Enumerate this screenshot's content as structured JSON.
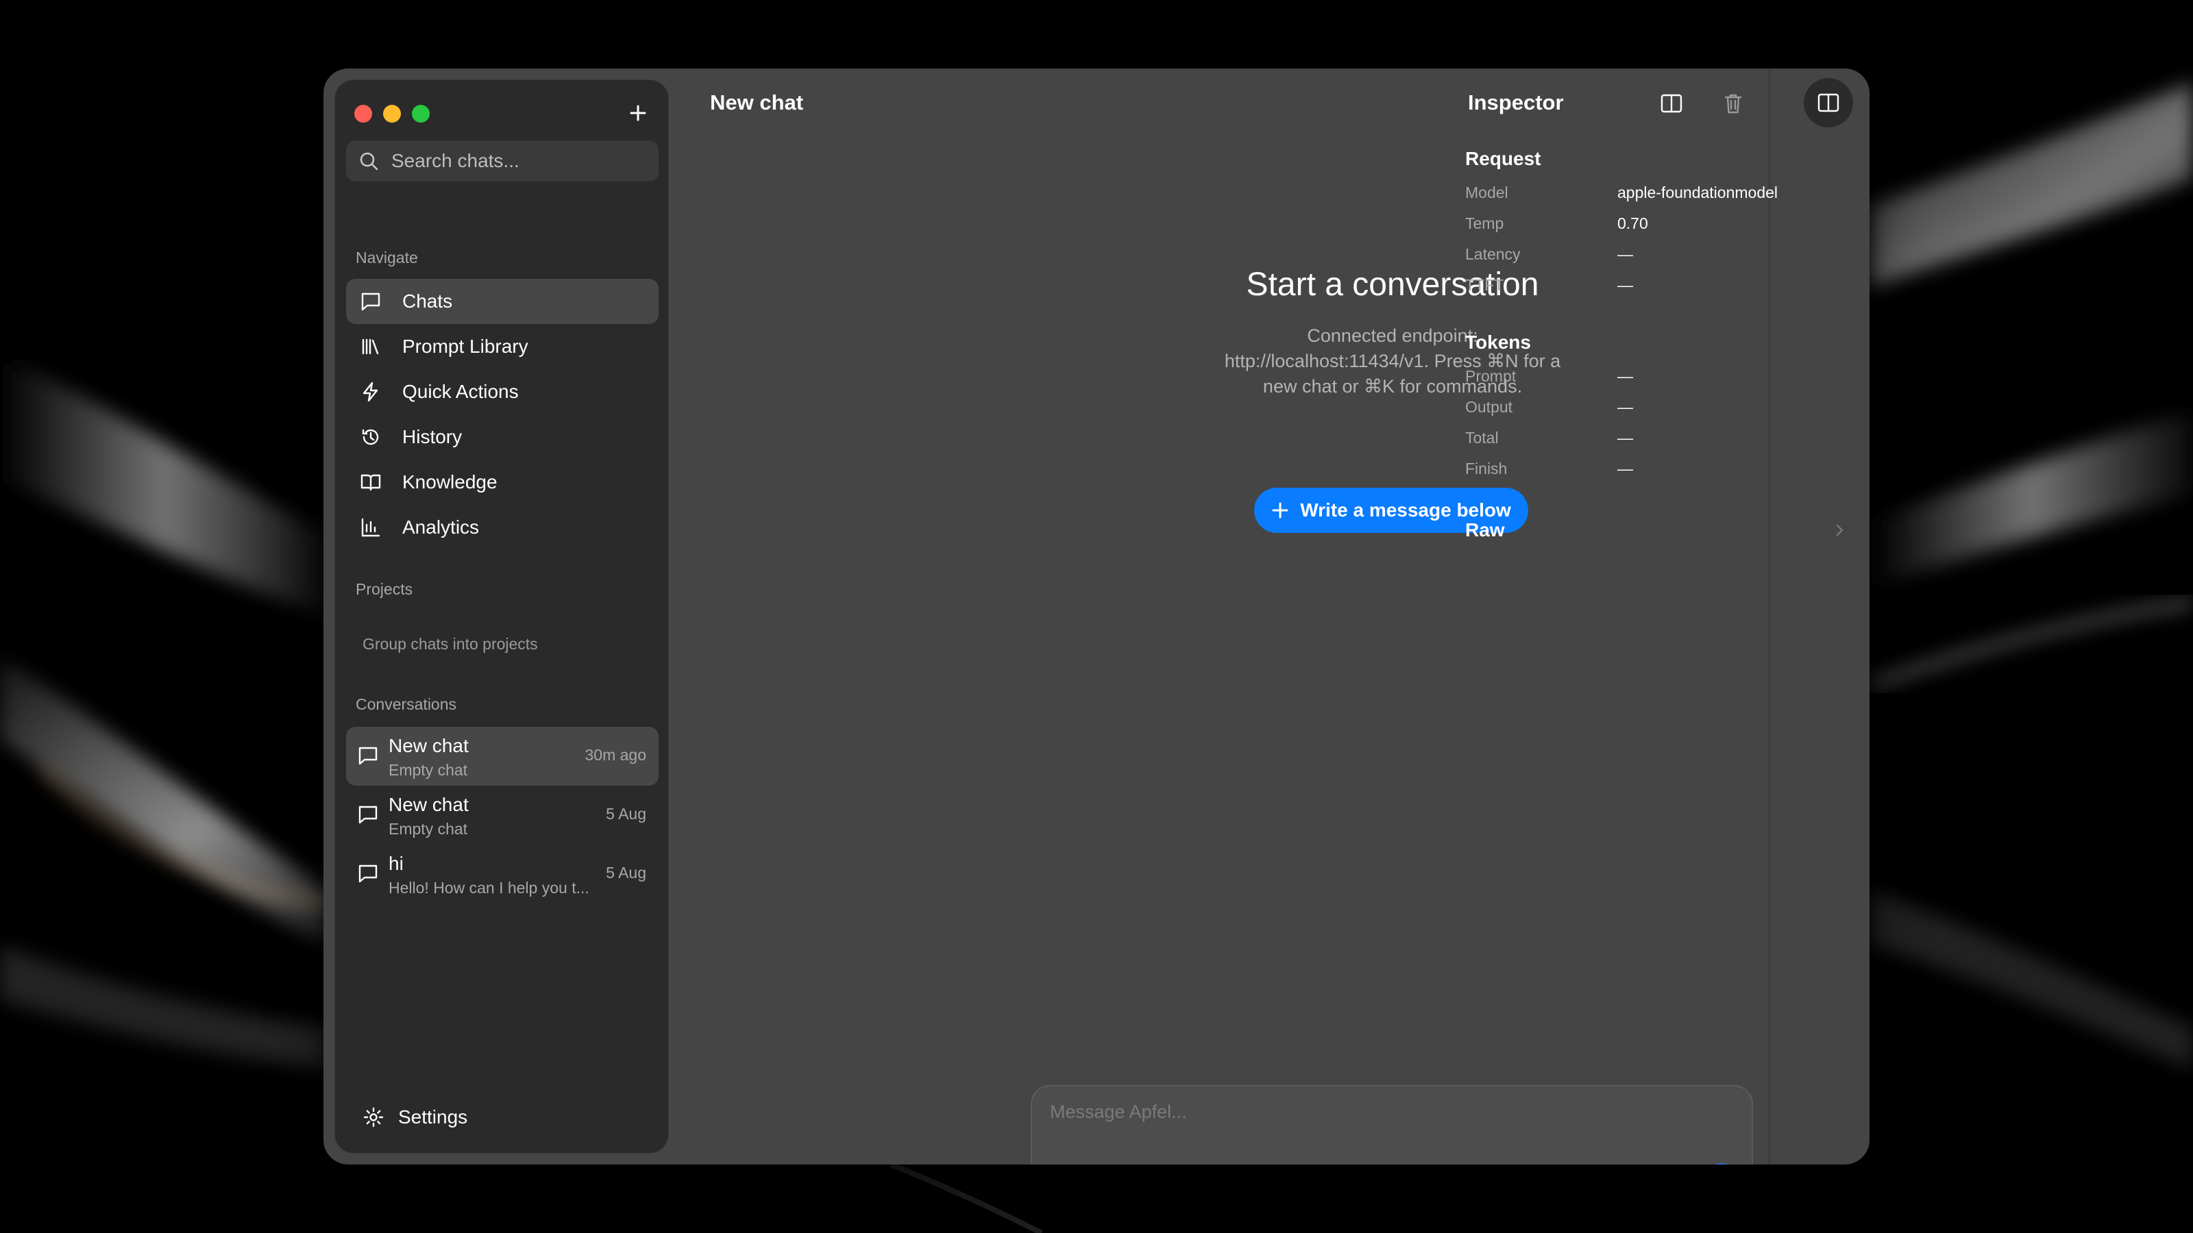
{
  "sidebar": {
    "search_placeholder": "Search chats...",
    "navigate_label": "Navigate",
    "nav_items": [
      {
        "label": "Chats",
        "icon": "chat-bubble-icon",
        "active": true
      },
      {
        "label": "Prompt Library",
        "icon": "library-icon"
      },
      {
        "label": "Quick Actions",
        "icon": "bolt-icon"
      },
      {
        "label": "History",
        "icon": "history-icon"
      },
      {
        "label": "Knowledge",
        "icon": "book-icon"
      },
      {
        "label": "Analytics",
        "icon": "bar-chart-icon"
      }
    ],
    "projects_label": "Projects",
    "projects_placeholder": "Group chats into projects",
    "conversations_label": "Conversations",
    "conversations": [
      {
        "title": "New chat",
        "subtitle": "Empty chat",
        "date": "30m ago",
        "active": true
      },
      {
        "title": "New chat",
        "subtitle": "Empty chat",
        "date": "5 Aug"
      },
      {
        "title": "hi",
        "subtitle": "Hello! How can I help you t...",
        "date": "5 Aug"
      }
    ],
    "settings_label": "Settings"
  },
  "main": {
    "title": "New chat",
    "hero_title": "Start a conversation",
    "hero_sub_1": "Connected endpoint:",
    "hero_sub_2": "http://localhost:11434/v1. Press ⌘N for a",
    "hero_sub_3": "new chat or ⌘K for commands.",
    "cta_label": "Write a message below",
    "composer_placeholder": "Message Apfel...",
    "composer_model": "apple-foundationmodel"
  },
  "inspector": {
    "title": "Inspector",
    "request_label": "Request",
    "request": [
      {
        "key": "Model",
        "value": "apple-foundationmodel"
      },
      {
        "key": "Temp",
        "value": "0.70"
      },
      {
        "key": "Latency",
        "value": "—"
      },
      {
        "key": "TTFT",
        "value": "—"
      }
    ],
    "tokens_label": "Tokens",
    "tokens": [
      {
        "key": "Prompt",
        "value": "—"
      },
      {
        "key": "Output",
        "value": "—"
      },
      {
        "key": "Total",
        "value": "—"
      },
      {
        "key": "Finish",
        "value": "—"
      }
    ],
    "raw_label": "Raw"
  },
  "colors": {
    "accent": "#0a7cff",
    "window_bg": "#454545",
    "sidebar_bg": "#2a2a2a",
    "traffic_red": "#ff5f57",
    "traffic_yellow": "#febc2e",
    "traffic_green": "#28c840"
  }
}
